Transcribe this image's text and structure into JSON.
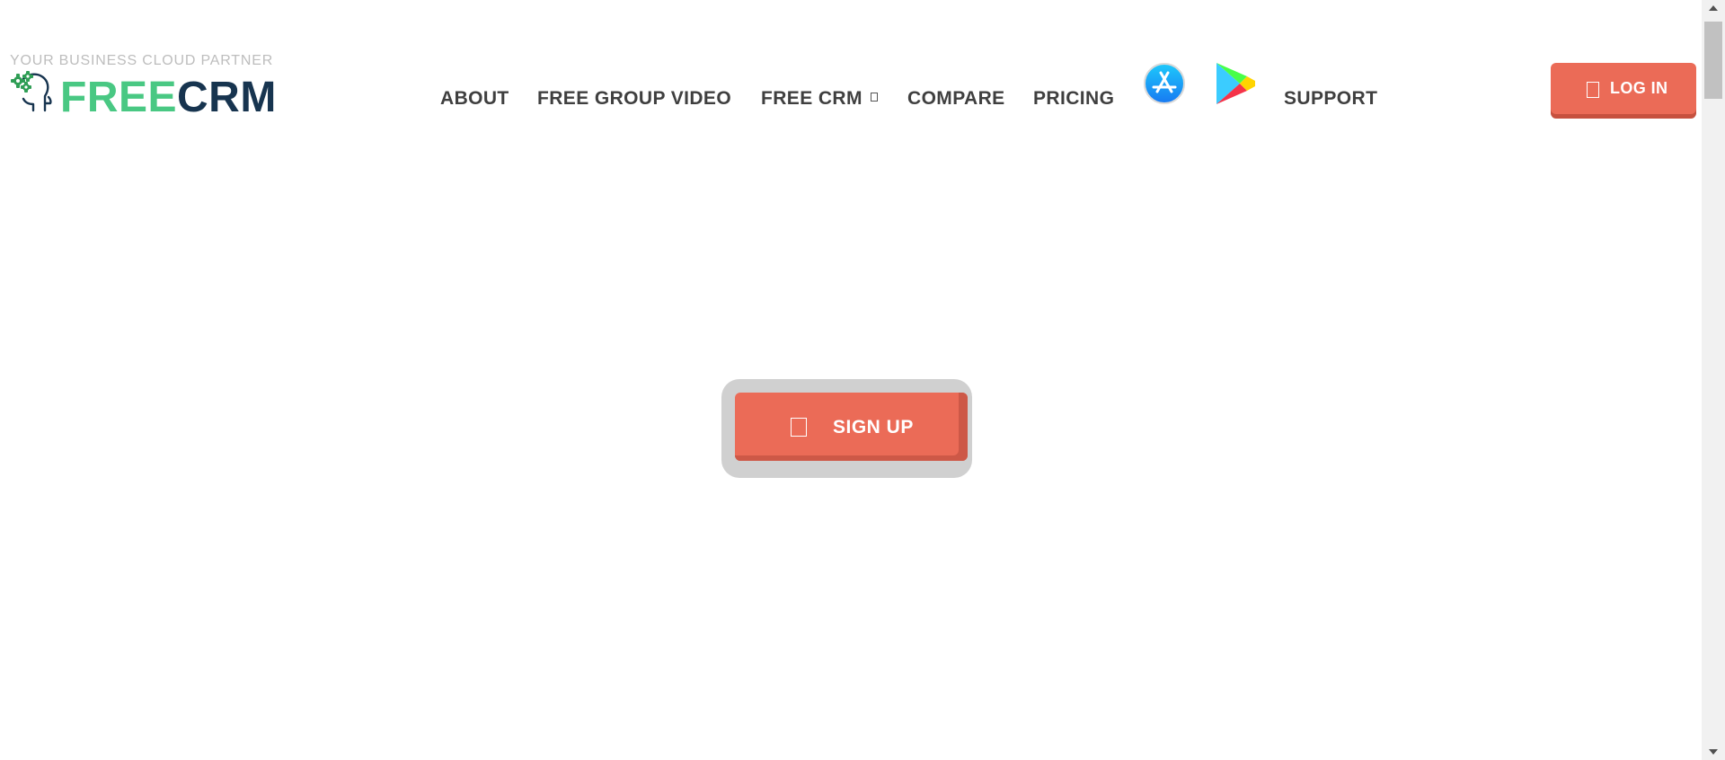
{
  "logo": {
    "tagline": "YOUR BUSINESS CLOUD PARTNER",
    "brand_free": "FREE",
    "brand_crm": "CRM",
    "icon": "head-gears-icon"
  },
  "nav": {
    "about": "ABOUT",
    "free_group_video": "FREE GROUP VIDEO",
    "free_crm": "FREE CRM",
    "free_crm_icon": "chevron-down-icon",
    "compare": "COMPARE",
    "pricing": "PRICING",
    "app_store_icon": "app-store-icon",
    "google_play_icon": "google-play-icon",
    "support": "SUPPORT"
  },
  "login": {
    "label": "LOG IN",
    "icon": "sign-in-icon"
  },
  "signup": {
    "label": "SIGN UP",
    "icon": "user-plus-icon"
  },
  "colors": {
    "accent": "#eb6b57",
    "brand_green": "#49c883",
    "brand_navy": "#17344f",
    "nav_text": "#3f3f3f"
  }
}
